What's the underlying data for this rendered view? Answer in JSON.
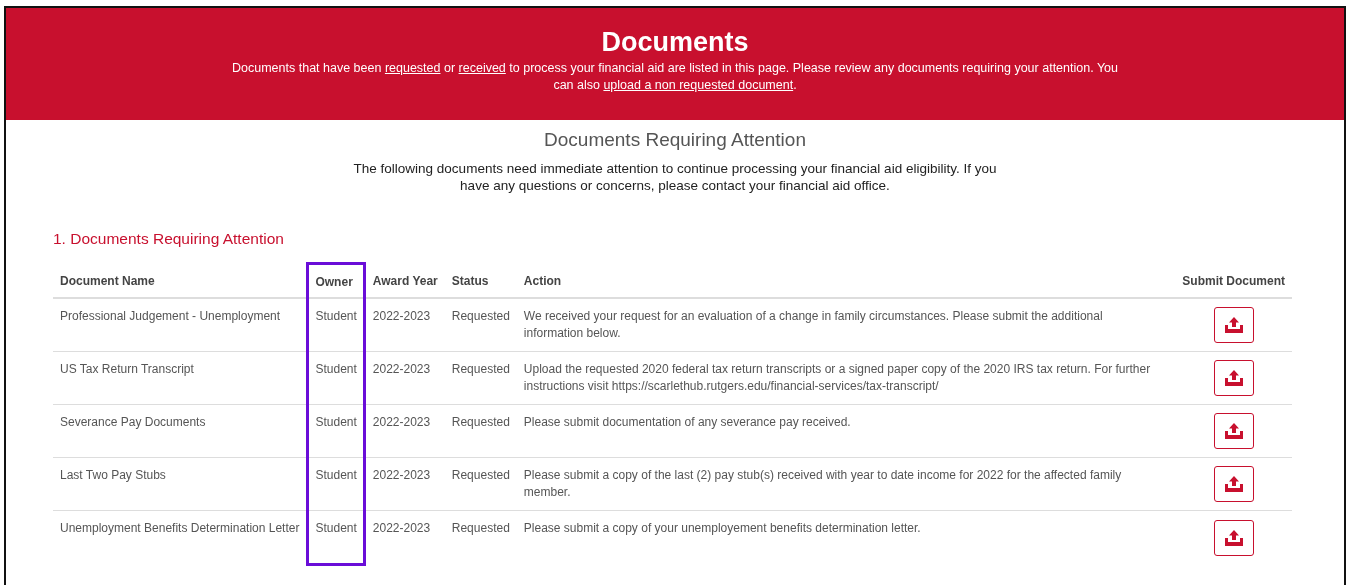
{
  "banner": {
    "title": "Documents",
    "description": [
      {
        "kind": "text",
        "text": "Documents that have been "
      },
      {
        "kind": "link",
        "text": "requested"
      },
      {
        "kind": "text",
        "text": " or "
      },
      {
        "kind": "link",
        "text": "received"
      },
      {
        "kind": "text",
        "text": " to process your financial aid are listed in this page. Please review any documents requiring your attention. You can also "
      },
      {
        "kind": "link",
        "text": "upload a non requested document"
      },
      {
        "kind": "text",
        "text": "."
      }
    ]
  },
  "intro": {
    "title": "Documents Requiring Attention",
    "text": "The following documents need immediate attention to continue processing your financial aid eligibility. If you have any questions or concerns, please contact your financial aid office."
  },
  "section": {
    "title": "1. Documents Requiring Attention",
    "table": {
      "columns": [
        {
          "label": "Document Name",
          "highlighted": false
        },
        {
          "label": "Owner",
          "highlighted": true
        },
        {
          "label": "Award Year",
          "highlighted": false
        },
        {
          "label": "Status",
          "highlighted": false
        },
        {
          "label": "Action",
          "highlighted": false
        },
        {
          "label": "Submit Document",
          "highlighted": false
        }
      ],
      "rows": [
        {
          "document_name": "Professional Judgement - Unemployment",
          "owner": "Student",
          "award_year": "2022-2023",
          "status": "Requested",
          "action": "We received your request for an evaluation of a change in family circumstances. Please submit the additional information below."
        },
        {
          "document_name": "US Tax Return Transcript",
          "owner": "Student",
          "award_year": "2022-2023",
          "status": "Requested",
          "action": "Upload the requested 2020 federal tax return transcripts or a signed paper copy of the 2020 IRS tax return. For further instructions visit https://scarlethub.rutgers.edu/financial-services/tax-transcript/"
        },
        {
          "document_name": "Severance Pay Documents",
          "owner": "Student",
          "award_year": "2022-2023",
          "status": "Requested",
          "action": "Please submit documentation of any severance pay received."
        },
        {
          "document_name": "Last Two Pay Stubs",
          "owner": "Student",
          "award_year": "2022-2023",
          "status": "Requested",
          "action": "Please submit a copy of the last (2) pay stub(s) received with year to date income for 2022 for the affected family member."
        },
        {
          "document_name": "Unemployment Benefits Determination Letter",
          "owner": "Student",
          "award_year": "2022-2023",
          "status": "Requested",
          "action": "Please submit a copy of your unemployement benefits determination letter."
        }
      ]
    }
  }
}
